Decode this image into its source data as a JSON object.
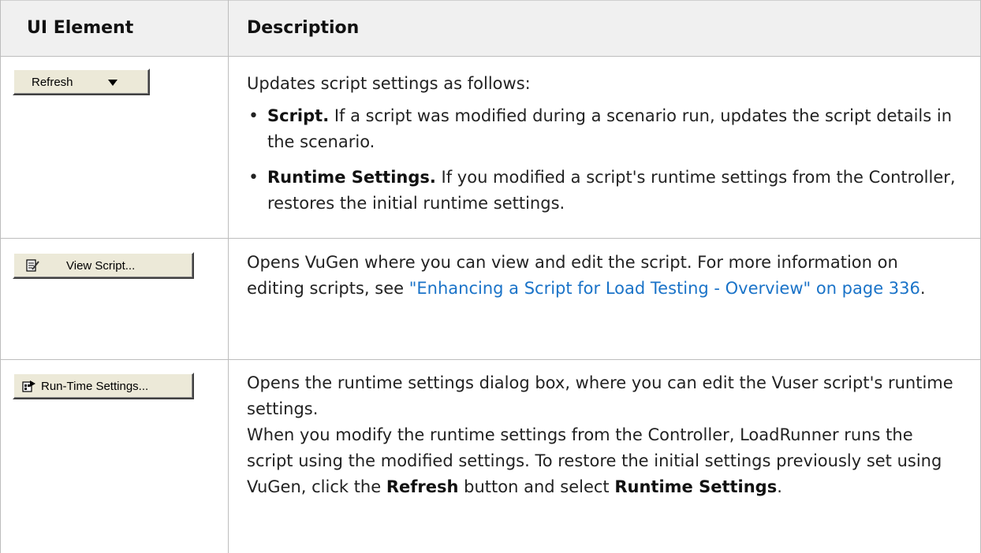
{
  "table": {
    "headers": {
      "ui_element": "UI Element",
      "description": "Description"
    },
    "rows": [
      {
        "button_label": "Refresh",
        "button_icon": "chevron-down-icon",
        "intro": "Updates script settings as follows:",
        "bullets": [
          {
            "term": "Script.",
            "text": " If a script was modified during a scenario run, updates the script details in the scenario."
          },
          {
            "term": "Runtime Settings.",
            "text": " If you modified a script's runtime settings from the Controller, restores the initial runtime settings."
          }
        ]
      },
      {
        "button_label": "View Script...",
        "button_icon": "script-edit-icon",
        "text_before": "Opens VuGen where you can view and edit the script. For more information on editing scripts, see ",
        "link_text": "\"Enhancing a Script for Load Testing - Overview\" on page 336",
        "text_after": "."
      },
      {
        "button_label": "Run-Time Settings...",
        "button_icon": "runtime-settings-icon",
        "para1": "Opens the runtime settings dialog box, where you can edit the Vuser script's runtime settings.",
        "para2_before": "When you modify the runtime settings from the Controller, LoadRunner runs the script using the modified settings. To restore the initial settings previously set using VuGen, click the ",
        "para2_bold1": "Refresh",
        "para2_mid": " button and select ",
        "para2_bold2": "Runtime Settings",
        "para2_after": "."
      }
    ]
  }
}
